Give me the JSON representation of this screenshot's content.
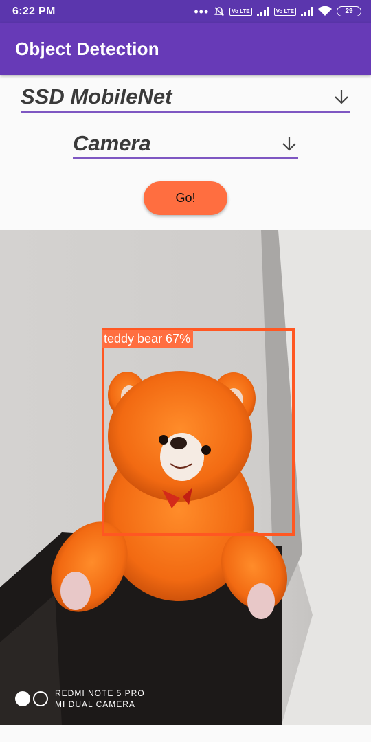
{
  "status_bar": {
    "time": "6:22 PM",
    "dots": "•••",
    "volte_1": "Vo LTE",
    "volte_2": "Vo LTE",
    "battery": "29"
  },
  "app_bar": {
    "title": "Object Detection"
  },
  "model_spinner": {
    "selected": "SSD MobileNet",
    "icon": "arrow-down-icon"
  },
  "source_spinner": {
    "selected": "Camera",
    "icon": "arrow-down-icon"
  },
  "go_button": {
    "label": "Go!"
  },
  "detection": {
    "label": "teddy bear 67%",
    "color": "#ff5722"
  },
  "watermark": {
    "line1": "REDMI NOTE 5 PRO",
    "line2": "MI DUAL CAMERA"
  },
  "colors": {
    "status_bar": "#5b36ad",
    "app_bar": "#673ab7",
    "accent": "#7e57c2",
    "button": "#ff6e40"
  }
}
